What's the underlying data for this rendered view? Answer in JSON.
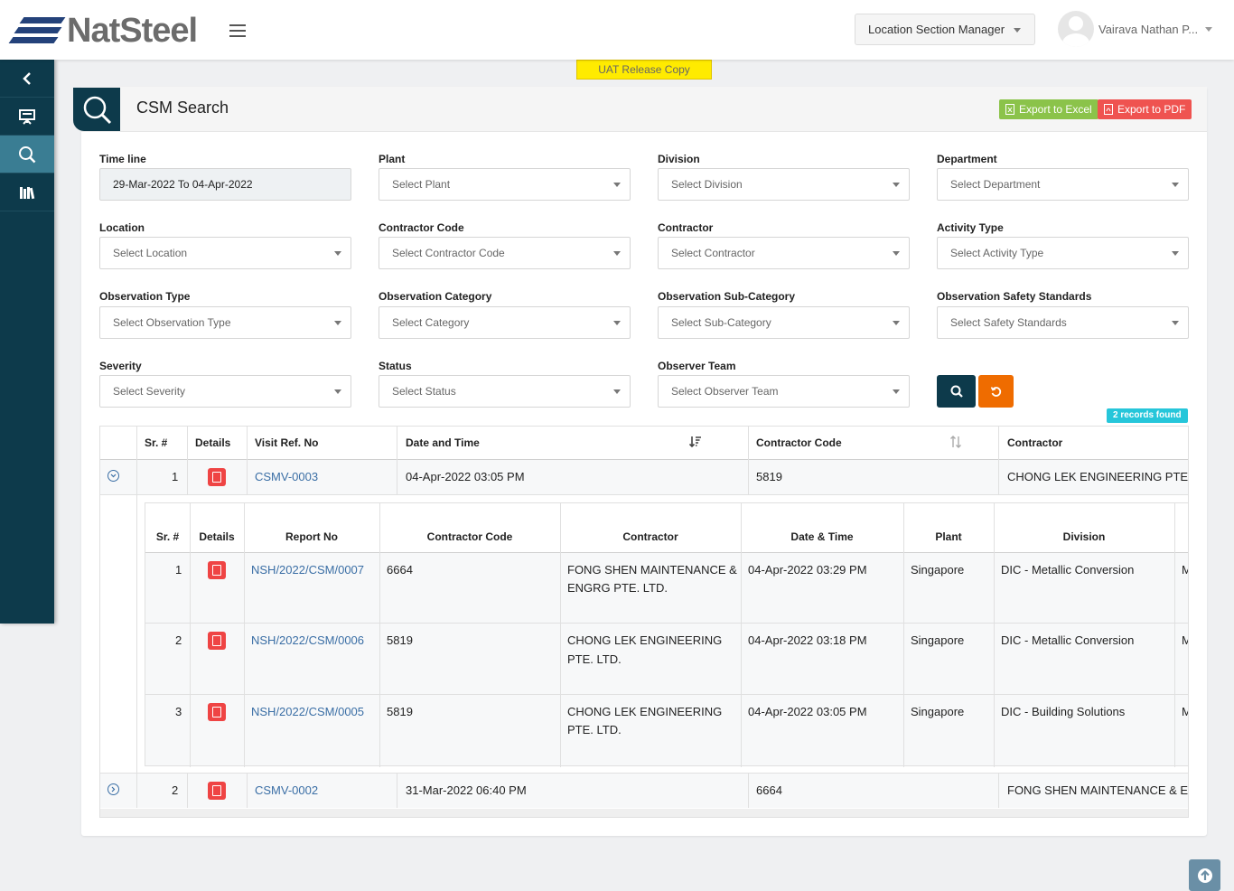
{
  "header": {
    "brand": "NatSteel",
    "role": "Location Section Manager",
    "user_name": "Vairava Nathan P..."
  },
  "banner": "UAT Release Copy",
  "page": {
    "title": "CSM Search",
    "export_excel": "Export to Excel",
    "export_pdf": "Export to PDF"
  },
  "filters": {
    "timeline": {
      "label": "Time line",
      "value": "29-Mar-2022 To 04-Apr-2022"
    },
    "plant": {
      "label": "Plant",
      "value": "Select Plant"
    },
    "division": {
      "label": "Division",
      "value": "Select Division"
    },
    "department": {
      "label": "Department",
      "value": "Select Department"
    },
    "location": {
      "label": "Location",
      "value": "Select Location"
    },
    "contractor_code": {
      "label": "Contractor Code",
      "value": "Select Contractor Code"
    },
    "contractor": {
      "label": "Contractor",
      "value": "Select Contractor"
    },
    "activity_type": {
      "label": "Activity Type",
      "value": "Select Activity Type"
    },
    "observation_type": {
      "label": "Observation Type",
      "value": "Select Observation Type"
    },
    "observation_category": {
      "label": "Observation Category",
      "value": "Select Category"
    },
    "observation_subcategory": {
      "label": "Observation Sub-Category",
      "value": "Select Sub-Category"
    },
    "safety_standards": {
      "label": "Observation Safety Standards",
      "value": "Select Safety Standards"
    },
    "severity": {
      "label": "Severity",
      "value": "Select Severity"
    },
    "status": {
      "label": "Status",
      "value": "Select Status"
    },
    "observer_team": {
      "label": "Observer Team",
      "value": "Select Observer Team"
    }
  },
  "records_found": "2 records found",
  "grid": {
    "columns": [
      "Sr. #",
      "Details",
      "Visit Ref. No",
      "Date and Time",
      "Contractor Code",
      "Contractor"
    ],
    "rows": [
      {
        "sr": "1",
        "ref": "CSMV-0003",
        "date": "04-Apr-2022 03:05 PM",
        "code": "5819",
        "contractor": "CHONG LEK ENGINEERING PTE. LTD."
      },
      {
        "sr": "2",
        "ref": "CSMV-0002",
        "date": "31-Mar-2022 06:40 PM",
        "code": "6664",
        "contractor": "FONG SHEN MAINTENANCE & ENGRG PTE. LTD."
      }
    ]
  },
  "subgrid": {
    "columns": [
      "Sr. #",
      "Details",
      "Report No",
      "Contractor Code",
      "Contractor",
      "Date & Time",
      "Plant",
      "Division"
    ],
    "rows": [
      {
        "sr": "1",
        "report": "NSH/2022/CSM/0007",
        "code": "6664",
        "contractor_1": "FONG SHEN MAINTENANCE &",
        "contractor_2": "ENGRG PTE. LTD.",
        "date": "04-Apr-2022 03:29 PM",
        "plant": "Singapore",
        "division": "DIC - Metallic Conversion",
        "extra": "M"
      },
      {
        "sr": "2",
        "report": "NSH/2022/CSM/0006",
        "code": "5819",
        "contractor_1": "CHONG LEK ENGINEERING",
        "contractor_2": "PTE. LTD.",
        "date": "04-Apr-2022 03:18 PM",
        "plant": "Singapore",
        "division": "DIC - Metallic Conversion",
        "extra": "M"
      },
      {
        "sr": "3",
        "report": "NSH/2022/CSM/0005",
        "code": "5819",
        "contractor_1": "CHONG LEK ENGINEERING",
        "contractor_2": "PTE. LTD.",
        "date": "04-Apr-2022 03:05 PM",
        "plant": "Singapore",
        "division": "DIC - Building Solutions",
        "extra": "M"
      }
    ]
  },
  "icons": {
    "sidebar": [
      "chevron-left-icon",
      "presentation-icon",
      "search-icon",
      "library-icon"
    ],
    "sort_desc": "sort-desc-icon",
    "sort_both": "sort-icon"
  },
  "colors": {
    "brand_dark": "#0d3a4b",
    "active": "#3a7d93",
    "excel": "#8bc34a",
    "pdf": "#ef5350",
    "reset": "#ef6c00",
    "badge": "#26c6da",
    "banner": "#ffeb00"
  }
}
